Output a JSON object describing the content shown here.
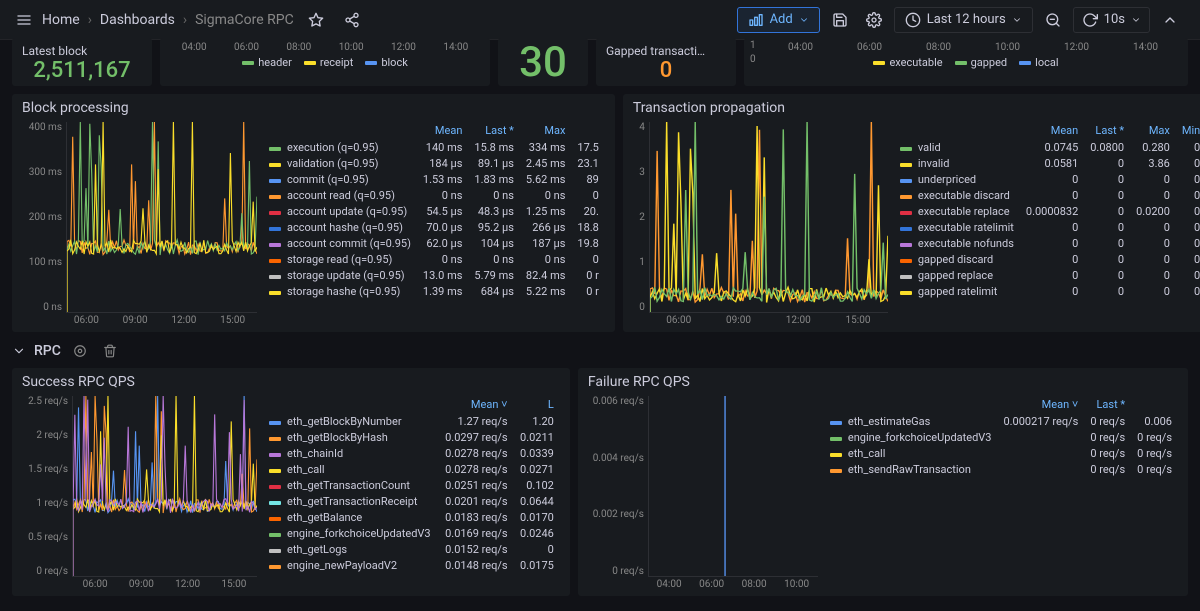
{
  "nav": {
    "home": "Home",
    "dashboards": "Dashboards",
    "current": "SigmaCore RPC",
    "add": "Add",
    "timerange": "Last 12 hours",
    "refresh": "10s"
  },
  "toprow": {
    "latest_block": {
      "title": "Latest block",
      "value": "2,511,167"
    },
    "mini1": {
      "ticks": [
        "04:00",
        "06:00",
        "08:00",
        "10:00",
        "12:00",
        "14:00"
      ],
      "legend": [
        {
          "color": "#73bf69",
          "label": "header"
        },
        {
          "color": "#fade2a",
          "label": "receipt"
        },
        {
          "color": "#5794f2",
          "label": "block"
        }
      ]
    },
    "connected": {
      "value": "30"
    },
    "gapped": {
      "title": "Gapped transacti…",
      "value": "0"
    },
    "mini2": {
      "ticks": [
        "04:00",
        "06:00",
        "08:00",
        "10:00",
        "12:00",
        "14:00"
      ],
      "yticks": [
        "1",
        "0"
      ],
      "legend": [
        {
          "color": "#fade2a",
          "label": "executable"
        },
        {
          "color": "#73bf69",
          "label": "gapped"
        },
        {
          "color": "#5794f2",
          "label": "local"
        }
      ]
    }
  },
  "block_processing": {
    "title": "Block processing",
    "yaxis": [
      "400 ms",
      "300 ms",
      "200 ms",
      "100 ms",
      "0 ns"
    ],
    "xaxis": [
      "06:00",
      "09:00",
      "12:00",
      "15:00"
    ],
    "cols": [
      "",
      "Mean",
      "Last *",
      "Max",
      ""
    ],
    "rows": [
      {
        "c": "#73bf69",
        "n": "execution (q=0.95)",
        "v": [
          "140 ms",
          "15.8 ms",
          "334 ms",
          "17.5"
        ]
      },
      {
        "c": "#fade2a",
        "n": "validation (q=0.95)",
        "v": [
          "184 µs",
          "89.1 µs",
          "2.45 ms",
          "23.1"
        ]
      },
      {
        "c": "#5794f2",
        "n": "commit (q=0.95)",
        "v": [
          "1.53 ms",
          "1.83 ms",
          "5.62 ms",
          "89"
        ]
      },
      {
        "c": "#ff9830",
        "n": "account read (q=0.95)",
        "v": [
          "0 ns",
          "0 ns",
          "0 ns",
          "0"
        ]
      },
      {
        "c": "#e02f44",
        "n": "account update (q=0.95)",
        "v": [
          "54.5 µs",
          "48.3 µs",
          "1.25 ms",
          "20."
        ]
      },
      {
        "c": "#3274d9",
        "n": "account hashe (q=0.95)",
        "v": [
          "70.0 µs",
          "95.2 µs",
          "266 µs",
          "18.8"
        ]
      },
      {
        "c": "#b877d9",
        "n": "account commit (q=0.95)",
        "v": [
          "62.0 µs",
          "104 µs",
          "187 µs",
          "19.8"
        ]
      },
      {
        "c": "#fa6400",
        "n": "storage read (q=0.95)",
        "v": [
          "0 ns",
          "0 ns",
          "0 ns",
          "0"
        ]
      },
      {
        "c": "#c0c0c0",
        "n": "storage update (q=0.95)",
        "v": [
          "13.0 ms",
          "5.79 ms",
          "82.4 ms",
          "0 r"
        ]
      },
      {
        "c": "#fade2a",
        "n": "storage hashe (q=0.95)",
        "v": [
          "1.39 ms",
          "684 µs",
          "5.22 ms",
          "0 r"
        ]
      }
    ]
  },
  "tx_propagation": {
    "title": "Transaction propagation",
    "yaxis": [
      "4",
      "3",
      "2",
      "1",
      "0"
    ],
    "xaxis": [
      "06:00",
      "09:00",
      "12:00",
      "15:00"
    ],
    "cols": [
      "",
      "Mean",
      "Last *",
      "Max",
      "Min"
    ],
    "rows": [
      {
        "c": "#73bf69",
        "n": "valid",
        "v": [
          "0.0745",
          "0.0800",
          "0.280",
          "0"
        ]
      },
      {
        "c": "#fade2a",
        "n": "invalid",
        "v": [
          "0.0581",
          "0",
          "3.86",
          "0"
        ]
      },
      {
        "c": "#5794f2",
        "n": "underpriced",
        "v": [
          "0",
          "0",
          "0",
          "0"
        ]
      },
      {
        "c": "#ff9830",
        "n": "executable discard",
        "v": [
          "0",
          "0",
          "0",
          "0"
        ]
      },
      {
        "c": "#e02f44",
        "n": "executable replace",
        "v": [
          "0.0000832",
          "0",
          "0.0200",
          "0"
        ]
      },
      {
        "c": "#3274d9",
        "n": "executable ratelimit",
        "v": [
          "0",
          "0",
          "0",
          "0"
        ]
      },
      {
        "c": "#b877d9",
        "n": "executable nofunds",
        "v": [
          "0",
          "0",
          "0",
          "0"
        ]
      },
      {
        "c": "#fa6400",
        "n": "gapped discard",
        "v": [
          "0",
          "0",
          "0",
          "0"
        ]
      },
      {
        "c": "#c0c0c0",
        "n": "gapped replace",
        "v": [
          "0",
          "0",
          "0",
          "0"
        ]
      },
      {
        "c": "#fade2a",
        "n": "gapped ratelimit",
        "v": [
          "0",
          "0",
          "0",
          "0"
        ]
      }
    ]
  },
  "rpc_header": {
    "title": "RPC"
  },
  "success_qps": {
    "title": "Success RPC QPS",
    "yaxis": [
      "2.5 req/s",
      "2 req/s",
      "1.5 req/s",
      "1 req/s",
      "0.5 req/s",
      "0 req/s"
    ],
    "xaxis": [
      "06:00",
      "09:00",
      "12:00",
      "15:00"
    ],
    "cols": [
      "",
      "Mean ˅",
      "L"
    ],
    "rows": [
      {
        "c": "#5794f2",
        "n": "eth_getBlockByNumber",
        "v": [
          "1.27 req/s",
          "1.20"
        ]
      },
      {
        "c": "#ff9830",
        "n": "eth_getBlockByHash",
        "v": [
          "0.0297 req/s",
          "0.0211"
        ]
      },
      {
        "c": "#b877d9",
        "n": "eth_chainId",
        "v": [
          "0.0278 req/s",
          "0.0339"
        ]
      },
      {
        "c": "#fade2a",
        "n": "eth_call",
        "v": [
          "0.0278 req/s",
          "0.0271"
        ]
      },
      {
        "c": "#e02f44",
        "n": "eth_getTransactionCount",
        "v": [
          "0.0251 req/s",
          "0.102"
        ]
      },
      {
        "c": "#73e5e5",
        "n": "eth_getTransactionReceipt",
        "v": [
          "0.0201 req/s",
          "0.0644"
        ]
      },
      {
        "c": "#fa6400",
        "n": "eth_getBalance",
        "v": [
          "0.0183 req/s",
          "0.0170"
        ]
      },
      {
        "c": "#73bf69",
        "n": "engine_forkchoiceUpdatedV3",
        "v": [
          "0.0169 req/s",
          "0.0246"
        ]
      },
      {
        "c": "#c0c0c0",
        "n": "eth_getLogs",
        "v": [
          "0.0152 req/s",
          "0"
        ]
      },
      {
        "c": "#ff9830",
        "n": "engine_newPayloadV2",
        "v": [
          "0.0148 req/s",
          "0.0175"
        ]
      }
    ]
  },
  "failure_qps": {
    "title": "Failure RPC QPS",
    "yaxis": [
      "0.006 req/s",
      "0.004 req/s",
      "0.002 req/s",
      "0 req/s"
    ],
    "xaxis": [
      "04:00",
      "06:00",
      "08:00",
      "10:00"
    ],
    "cols": [
      "",
      "Mean ˅",
      "Last *",
      ""
    ],
    "rows": [
      {
        "c": "#5794f2",
        "n": "eth_estimateGas",
        "v": [
          "0.000217 req/s",
          "0 req/s",
          "0.006"
        ]
      },
      {
        "c": "#73bf69",
        "n": "engine_forkchoiceUpdatedV3",
        "v": [
          "",
          "0 req/s",
          "0 req/s"
        ]
      },
      {
        "c": "#fade2a",
        "n": "eth_call",
        "v": [
          "",
          "0 req/s",
          "0 req/s"
        ]
      },
      {
        "c": "#ff9830",
        "n": "eth_sendRawTransaction",
        "v": [
          "",
          "0 req/s",
          "0 req/s"
        ]
      }
    ]
  },
  "colors": {
    "accent": "#3274d9",
    "link": "#6eb6ff"
  },
  "chart_data": [
    {
      "type": "line",
      "title": "Block processing",
      "ylim": [
        0,
        400
      ],
      "unit": "ms",
      "x": [
        "06:00",
        "09:00",
        "12:00",
        "15:00"
      ],
      "series": [
        {
          "name": "execution (q=0.95)",
          "mean": 140,
          "last": 15.8,
          "max": 334
        }
      ]
    },
    {
      "type": "line",
      "title": "Transaction propagation",
      "ylim": [
        0,
        4
      ],
      "x": [
        "06:00",
        "09:00",
        "12:00",
        "15:00"
      ],
      "series": [
        {
          "name": "valid",
          "mean": 0.0745,
          "last": 0.08,
          "max": 0.28,
          "min": 0
        },
        {
          "name": "invalid",
          "mean": 0.0581,
          "last": 0,
          "max": 3.86,
          "min": 0
        }
      ]
    },
    {
      "type": "line",
      "title": "Success RPC QPS",
      "ylim": [
        0,
        2.5
      ],
      "unit": "req/s",
      "x": [
        "06:00",
        "09:00",
        "12:00",
        "15:00"
      ],
      "series": [
        {
          "name": "eth_getBlockByNumber",
          "mean": 1.27,
          "last": 1.2
        }
      ]
    },
    {
      "type": "line",
      "title": "Failure RPC QPS",
      "ylim": [
        0,
        0.006
      ],
      "unit": "req/s",
      "x": [
        "04:00",
        "06:00",
        "08:00",
        "10:00"
      ],
      "series": [
        {
          "name": "eth_estimateGas",
          "mean": 0.000217,
          "last": 0,
          "max": 0.0067
        }
      ]
    }
  ]
}
